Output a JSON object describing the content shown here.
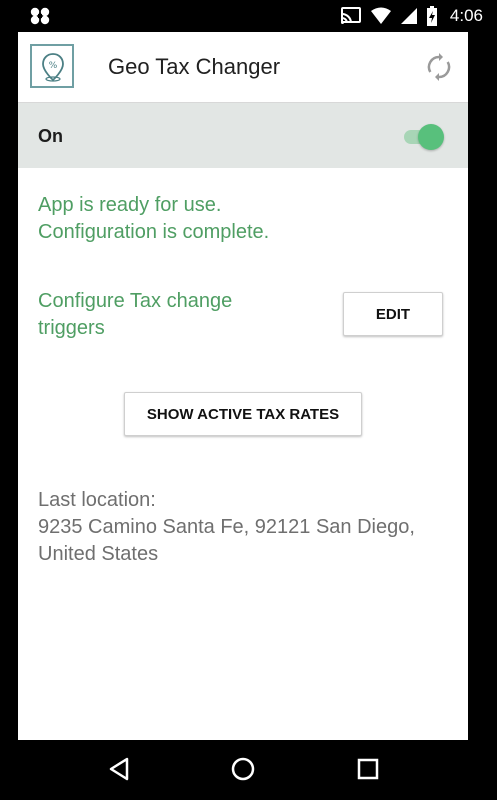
{
  "status_bar": {
    "time": "4:06",
    "icons": [
      "app-notification-icon",
      "cast-icon",
      "wifi-icon",
      "signal-icon",
      "battery-icon"
    ]
  },
  "toolbar": {
    "title": "Geo Tax Changer",
    "logo_icon": "geo-tax-logo-icon",
    "action_icon": "sync-icon"
  },
  "switch_row": {
    "label": "On",
    "state": true,
    "accent_color": "#58c07c"
  },
  "status": {
    "line1": "App is ready for use.",
    "line2": "Configuration is complete."
  },
  "trigger": {
    "text": "Configure Tax change triggers",
    "edit_label": "EDIT"
  },
  "rates_button_label": "SHOW ACTIVE TAX RATES",
  "location": {
    "label": "Last location:",
    "address": "9235 Camino Santa Fe, 92121 San Diego, United States"
  },
  "navigation": {
    "buttons": [
      "back-icon",
      "home-icon",
      "recents-icon"
    ]
  },
  "colors": {
    "status_green": "#4f9e63",
    "switchbar_bg": "#e2e6e4",
    "location_gray": "#6f6f6f"
  }
}
